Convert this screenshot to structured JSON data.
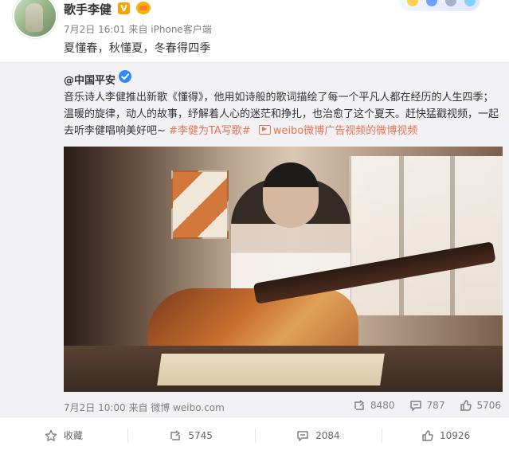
{
  "header": {
    "author_name": "歌手李健",
    "meta": "7月2日 16:01 来自 iPhone客户端",
    "post_text": "夏懂春，秋懂夏，冬春得四季"
  },
  "repost": {
    "original_author": "@中国平安",
    "body_main": "音乐诗人李健推出新歌《懂得》，他用如诗般的歌词描绘了每一个平凡人都在经历的人生四季；温暖的旋律，动人的故事，纾解着人心的迷茫和挣扎，也治愈了这个夏天。赶快猛戳视频，一起去听李健唱响美好吧~",
    "topic": "#李健为TA写歌#",
    "link_text": "weibo微博广告视频的微博视频",
    "meta": "7月2日 10:00 来自 微博 weibo.com",
    "mini_actions": {
      "share_count": "8480",
      "comment_count": "787",
      "like_count": "5706"
    }
  },
  "actions": {
    "favorite_label": "收藏",
    "share_count": "5745",
    "comment_count": "2084",
    "like_count": "10926"
  },
  "icons": {
    "verified_badge": "vip-v-icon",
    "crown_badge": "crown-badge-icon",
    "org_verified": "blue-check-icon",
    "link_icon": "video-link-icon",
    "share_icon": "share-icon",
    "comment_icon": "comment-icon",
    "like_icon": "thumb-up-icon",
    "favorite_icon": "star-icon"
  },
  "colors": {
    "topic": "#eb7350",
    "meta_gray": "#808080",
    "orange_v": "#f6a300",
    "blue_verified": "#2e8bff"
  }
}
